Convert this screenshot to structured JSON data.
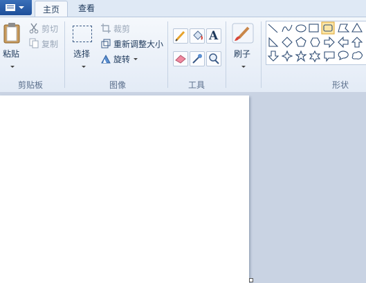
{
  "tabs": {
    "home": "主页",
    "view": "查看"
  },
  "clipboard": {
    "paste": "粘贴",
    "cut": "剪切",
    "copy": "复制",
    "group": "剪贴板"
  },
  "image": {
    "select": "选择",
    "crop": "裁剪",
    "resize": "重新调整大小",
    "rotate": "旋转",
    "group": "图像"
  },
  "tools": {
    "group": "工具",
    "text_glyph": "A"
  },
  "brushes": {
    "label": "刷子"
  },
  "shapes": {
    "group": "形状"
  },
  "colors": {
    "accent": "#1d4f9a",
    "highlight": "#f2c04c",
    "canvas": "#ffffff",
    "workspace": "#c9d3e3"
  }
}
